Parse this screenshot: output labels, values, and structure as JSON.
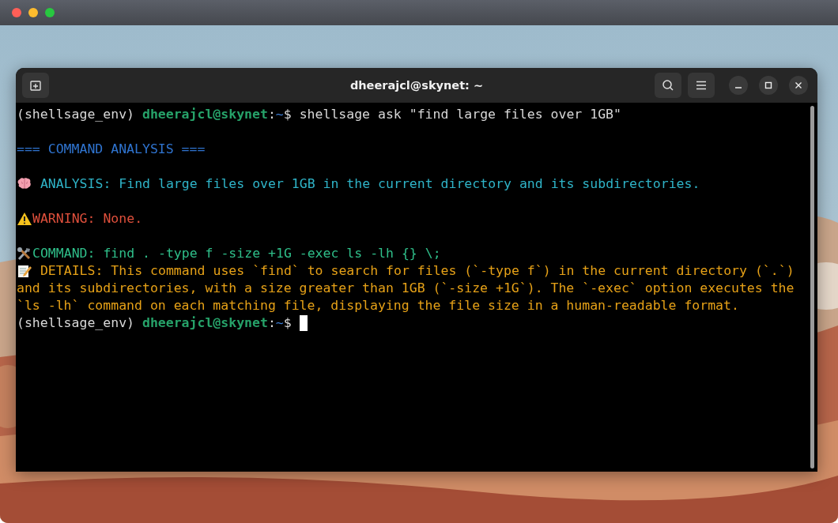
{
  "terminal": {
    "title": "dheerajcl@skynet: ~",
    "lines": [
      {
        "kind": "text",
        "segments": [
          {
            "kind": "plain",
            "text": "(shellsage_env) "
          },
          {
            "kind": "user",
            "text": "dheerajcl@skynet"
          },
          {
            "kind": "plain",
            "text": ":"
          },
          {
            "kind": "path",
            "text": "~"
          },
          {
            "kind": "plain",
            "text": "$ shellsage ask \"find large files over 1GB\""
          }
        ]
      },
      {
        "kind": "blank"
      },
      {
        "kind": "text",
        "segments": [
          {
            "kind": "header",
            "text": "=== COMMAND ANALYSIS ==="
          }
        ]
      },
      {
        "kind": "blank"
      },
      {
        "kind": "text",
        "segments": [
          {
            "kind": "brain"
          },
          {
            "kind": "analysis",
            "text": " ANALYSIS: Find large files over 1GB in the current directory and its subdirectories."
          }
        ]
      },
      {
        "kind": "blank"
      },
      {
        "kind": "text",
        "segments": [
          {
            "kind": "alert"
          },
          {
            "kind": "warning",
            "text": "WARNING: None."
          }
        ]
      },
      {
        "kind": "blank"
      },
      {
        "kind": "text",
        "segments": [
          {
            "kind": "tools"
          },
          {
            "kind": "command",
            "text": "COMMAND: find . -type f -size +1G -exec ls -lh {} \\;"
          }
        ]
      },
      {
        "kind": "text",
        "segments": [
          {
            "kind": "memo"
          },
          {
            "kind": "details",
            "text": " DETAILS: This command uses `find` to search for files (`-type f`) in the current directory (`.`)"
          }
        ]
      },
      {
        "kind": "text",
        "segments": [
          {
            "kind": "details",
            "text": "and its subdirectories, with a size greater than 1GB (`-size +1G`). The `-exec` option executes the"
          }
        ]
      },
      {
        "kind": "text",
        "segments": [
          {
            "kind": "details",
            "text": "`ls -lh` command on each matching file, displaying the file size in a human-readable format."
          }
        ]
      },
      {
        "kind": "text",
        "segments": [
          {
            "kind": "plain",
            "text": "(shellsage_env) "
          },
          {
            "kind": "user",
            "text": "dheerajcl@skynet"
          },
          {
            "kind": "plain",
            "text": ":"
          },
          {
            "kind": "path",
            "text": "~"
          },
          {
            "kind": "plain",
            "text": "$ "
          },
          {
            "kind": "cursor"
          }
        ]
      }
    ]
  }
}
